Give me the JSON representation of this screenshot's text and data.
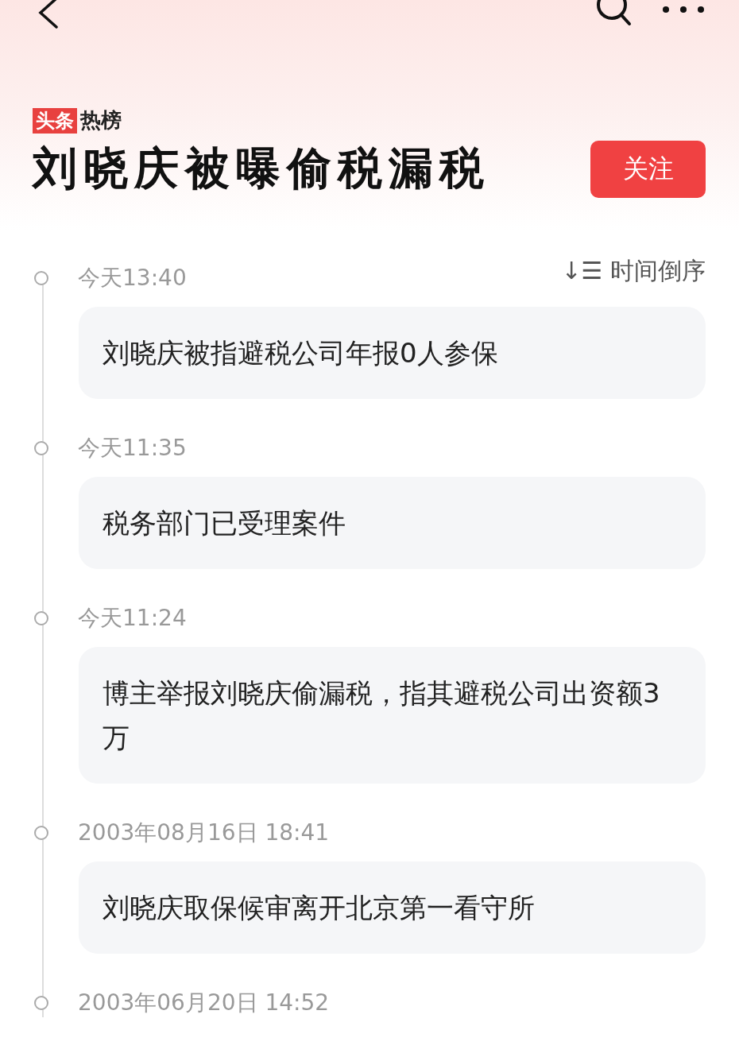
{
  "header": {
    "badge": "头条",
    "brand": "热榜",
    "title": "刘晓庆被曝偷税漏税",
    "follow_button": "关注"
  },
  "sort": {
    "icon": "↓☰",
    "label": "时间倒序"
  },
  "timeline": [
    {
      "time": "今天13:40",
      "text": "刘晓庆被指避税公司年报0人参保"
    },
    {
      "time": "今天11:35",
      "text": "税务部门已受理案件"
    },
    {
      "time": "今天11:24",
      "text": "博主举报刘晓庆偷漏税，指其避税公司出资额3万"
    },
    {
      "time": "2003年08月16日 18:41",
      "text": "刘晓庆取保候审离开北京第一看守所"
    },
    {
      "time": "2003年06月20日 14:52"
    }
  ]
}
